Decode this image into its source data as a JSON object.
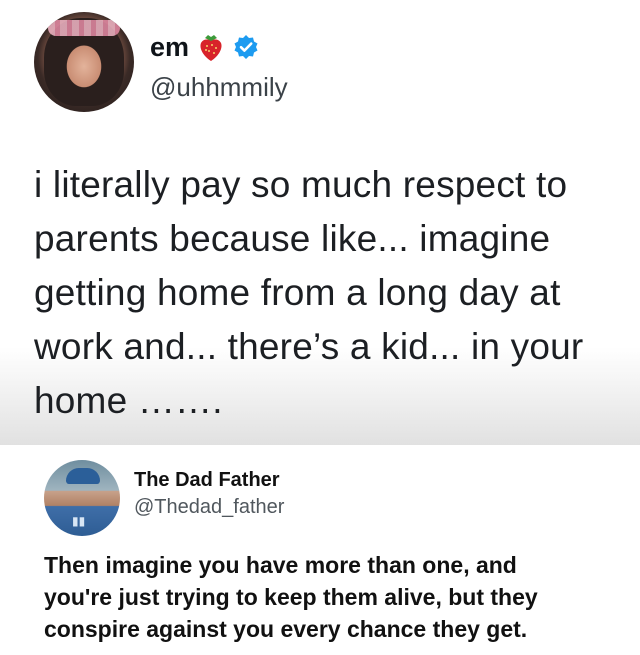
{
  "tweet": {
    "author_name": "em",
    "author_handle": "@uhhmmily",
    "lines": [
      "i literally pay so much respect to",
      "parents because like... imagine",
      "getting home from a long day at",
      "work and... there’s a kid... in your",
      "home ……."
    ],
    "icons": {
      "emoji": "strawberry-icon",
      "badge": "verified-icon"
    },
    "colors": {
      "verified": "#1d9bf0",
      "strawberry": "#d8232a"
    }
  },
  "reply": {
    "author_name": "The Dad Father",
    "author_handle": "@Thedad_father",
    "lines": [
      "Then imagine you have more than one, and",
      "you're just trying to keep them alive, but they",
      "conspire against you every chance they get."
    ]
  }
}
